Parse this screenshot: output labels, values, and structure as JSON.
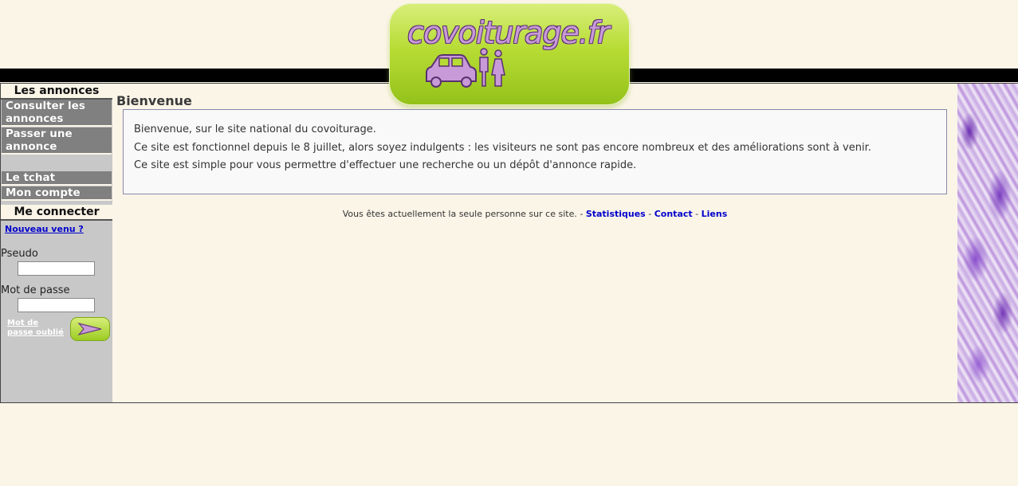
{
  "logo": {
    "text": "covoiturage.fr"
  },
  "sidebar": {
    "ads_heading": "Les annonces",
    "items": [
      {
        "label": "Consulter les annonces"
      },
      {
        "label": "Passer une annonce"
      },
      {
        "label": "Le tchat"
      },
      {
        "label": "Mon compte"
      }
    ],
    "login_heading": "Me connecter",
    "newcomer_link": "Nouveau venu ?",
    "pseudo_label": "Pseudo",
    "pseudo_value": "",
    "password_label": "Mot de passe",
    "password_value": "",
    "forgot_link": "Mot de passe oublié",
    "submit_icon": "arrow-right-icon"
  },
  "main": {
    "title": "Bienvenue",
    "paragraphs": [
      "Bienvenue, sur le site national du covoiturage.",
      "Ce site est fonctionnel depuis le 8 juillet, alors soyez indulgents : les visiteurs ne sont pas encore nombreux et des améliorations sont à venir.",
      "Ce site est simple pour vous permettre d'effectuer une recherche ou un dépôt d'annonce rapide."
    ]
  },
  "footer": {
    "text": "Vous êtes actuellement la seule personne sur ce site. -",
    "links": [
      {
        "label": "Statistiques"
      },
      {
        "label": "Contact"
      },
      {
        "label": "Liens"
      }
    ]
  },
  "colors": {
    "background": "#fbf5e8",
    "sidebar": "#c8c8c8",
    "menu_item": "#808080",
    "logo_green": "#b7dc34",
    "logo_text": "#c89ad8",
    "link": "#0000cc"
  }
}
